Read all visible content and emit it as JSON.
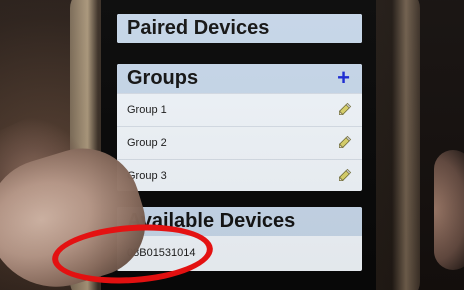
{
  "paired_devices": {
    "title": "Paired Devices"
  },
  "groups": {
    "title": "Groups",
    "add_label": "+",
    "items": [
      {
        "label": "Group 1",
        "edit_icon": "pencil-icon"
      },
      {
        "label": "Group 2",
        "edit_icon": "pencil-icon"
      },
      {
        "label": "Group 3",
        "edit_icon": "pencil-icon"
      }
    ]
  },
  "available_devices": {
    "title": "Available Devices",
    "items": [
      {
        "label": "08B01531014"
      }
    ]
  },
  "colors": {
    "header_background": "#c6d6e8",
    "row_background": "#eef3f8",
    "accent_blue": "#1a29d3",
    "annotation_red": "#ee1111"
  }
}
